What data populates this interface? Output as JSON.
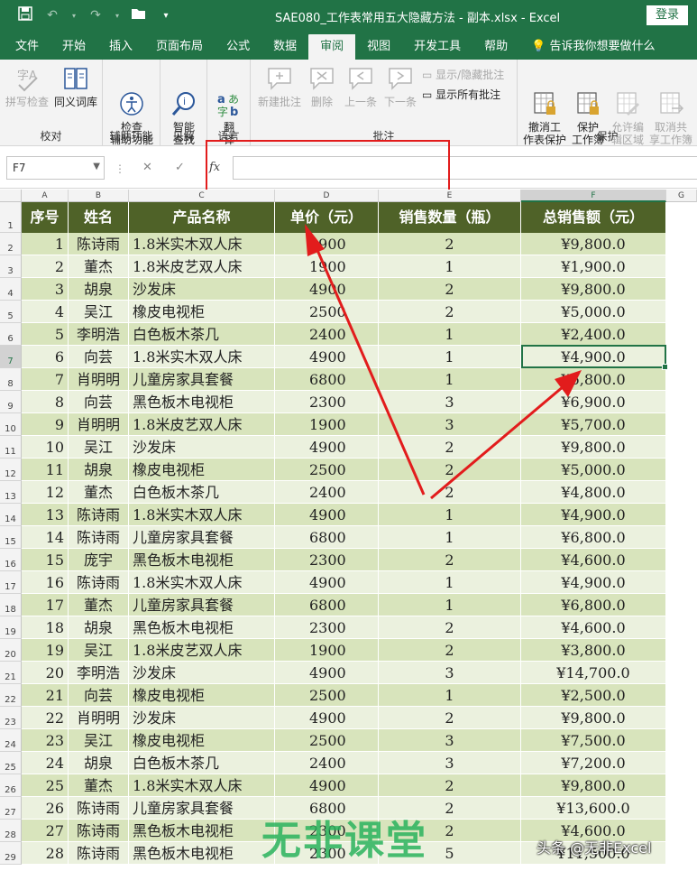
{
  "titlebar": {
    "title": "SAE080_工作表常用五大隐藏方法 - 副本.xlsx  -  Excel",
    "login": "登录"
  },
  "tabs": [
    "文件",
    "开始",
    "插入",
    "页面布局",
    "公式",
    "数据",
    "审阅",
    "视图",
    "开发工具",
    "帮助",
    "告诉我你想要做什么"
  ],
  "active_tab": "审阅",
  "ribbon": {
    "proofing": {
      "label": "校对",
      "spell": "拼写检查",
      "thesaurus": "同义词库"
    },
    "accessibility": {
      "label": "辅助功能",
      "check": "检查\n辅助功能"
    },
    "insights": {
      "label": "见解",
      "smart": "智能\n查找"
    },
    "language": {
      "label": "语言",
      "translate": "翻\n译"
    },
    "comments": {
      "label": "批注",
      "new": "新建批注",
      "delete": "删除",
      "prev": "上一条",
      "next": "下一条",
      "show_hide": "显示/隐藏批注",
      "show_all": "显示所有批注"
    },
    "protect": {
      "label": "保护",
      "unprotect_sheet": "撤消工\n作表保护",
      "protect_wb": "保护\n工作簿",
      "allow_edit": "允许编\n辑区域",
      "unshare": "取消共\n享工作簿"
    }
  },
  "formula_bar": {
    "name_box": "F7",
    "fx": "fx",
    "value": ""
  },
  "columns": [
    "A",
    "B",
    "C",
    "D",
    "E",
    "F",
    "G"
  ],
  "selected_column": "F",
  "selected_row": "7",
  "table": {
    "headers": [
      "序号",
      "姓名",
      "产品名称",
      "单价（元）",
      "销售数量（瓶）",
      "总销售额（元）"
    ],
    "rows": [
      [
        "1",
        "陈诗雨",
        "1.8米实木双人床",
        "4900",
        "2",
        "¥9,800.0"
      ],
      [
        "2",
        "董杰",
        "1.8米皮艺双人床",
        "1900",
        "1",
        "¥1,900.0"
      ],
      [
        "3",
        "胡泉",
        "沙发床",
        "4900",
        "2",
        "¥9,800.0"
      ],
      [
        "4",
        "吴江",
        "橡皮电视柜",
        "2500",
        "2",
        "¥5,000.0"
      ],
      [
        "5",
        "李明浩",
        "白色板木茶几",
        "2400",
        "1",
        "¥2,400.0"
      ],
      [
        "6",
        "向芸",
        "1.8米实木双人床",
        "4900",
        "1",
        "¥4,900.0"
      ],
      [
        "7",
        "肖明明",
        "儿童房家具套餐",
        "6800",
        "1",
        "¥6,800.0"
      ],
      [
        "8",
        "向芸",
        "黑色板木电视柜",
        "2300",
        "3",
        "¥6,900.0"
      ],
      [
        "9",
        "肖明明",
        "1.8米皮艺双人床",
        "1900",
        "3",
        "¥5,700.0"
      ],
      [
        "10",
        "吴江",
        "沙发床",
        "4900",
        "2",
        "¥9,800.0"
      ],
      [
        "11",
        "胡泉",
        "橡皮电视柜",
        "2500",
        "2",
        "¥5,000.0"
      ],
      [
        "12",
        "董杰",
        "白色板木茶几",
        "2400",
        "2",
        "¥4,800.0"
      ],
      [
        "13",
        "陈诗雨",
        "1.8米实木双人床",
        "4900",
        "1",
        "¥4,900.0"
      ],
      [
        "14",
        "陈诗雨",
        "儿童房家具套餐",
        "6800",
        "1",
        "¥6,800.0"
      ],
      [
        "15",
        "庞宇",
        "黑色板木电视柜",
        "2300",
        "2",
        "¥4,600.0"
      ],
      [
        "16",
        "陈诗雨",
        "1.8米实木双人床",
        "4900",
        "1",
        "¥4,900.0"
      ],
      [
        "17",
        "董杰",
        "儿童房家具套餐",
        "6800",
        "1",
        "¥6,800.0"
      ],
      [
        "18",
        "胡泉",
        "黑色板木电视柜",
        "2300",
        "2",
        "¥4,600.0"
      ],
      [
        "19",
        "吴江",
        "1.8米皮艺双人床",
        "1900",
        "2",
        "¥3,800.0"
      ],
      [
        "20",
        "李明浩",
        "沙发床",
        "4900",
        "3",
        "¥14,700.0"
      ],
      [
        "21",
        "向芸",
        "橡皮电视柜",
        "2500",
        "1",
        "¥2,500.0"
      ],
      [
        "22",
        "肖明明",
        "沙发床",
        "4900",
        "2",
        "¥9,800.0"
      ],
      [
        "23",
        "吴江",
        "橡皮电视柜",
        "2500",
        "3",
        "¥7,500.0"
      ],
      [
        "24",
        "胡泉",
        "白色板木茶几",
        "2400",
        "3",
        "¥7,200.0"
      ],
      [
        "25",
        "董杰",
        "1.8米实木双人床",
        "4900",
        "2",
        "¥9,800.0"
      ],
      [
        "26",
        "陈诗雨",
        "儿童房家具套餐",
        "6800",
        "2",
        "¥13,600.0"
      ],
      [
        "27",
        "陈诗雨",
        "黑色板木电视柜",
        "2300",
        "2",
        "¥4,600.0"
      ],
      [
        "28",
        "陈诗雨",
        "黑色板木电视柜",
        "2300",
        "5",
        "¥11,500.0"
      ]
    ]
  },
  "watermark": {
    "brand": "无非课堂",
    "credit": "头条 @无非Excel"
  },
  "colors": {
    "excel_green": "#217346",
    "header_fill": "#4f6228",
    "band_dark": "#d8e4bc",
    "band_light": "#ebf1de",
    "annotation_red": "#e21c1c"
  }
}
